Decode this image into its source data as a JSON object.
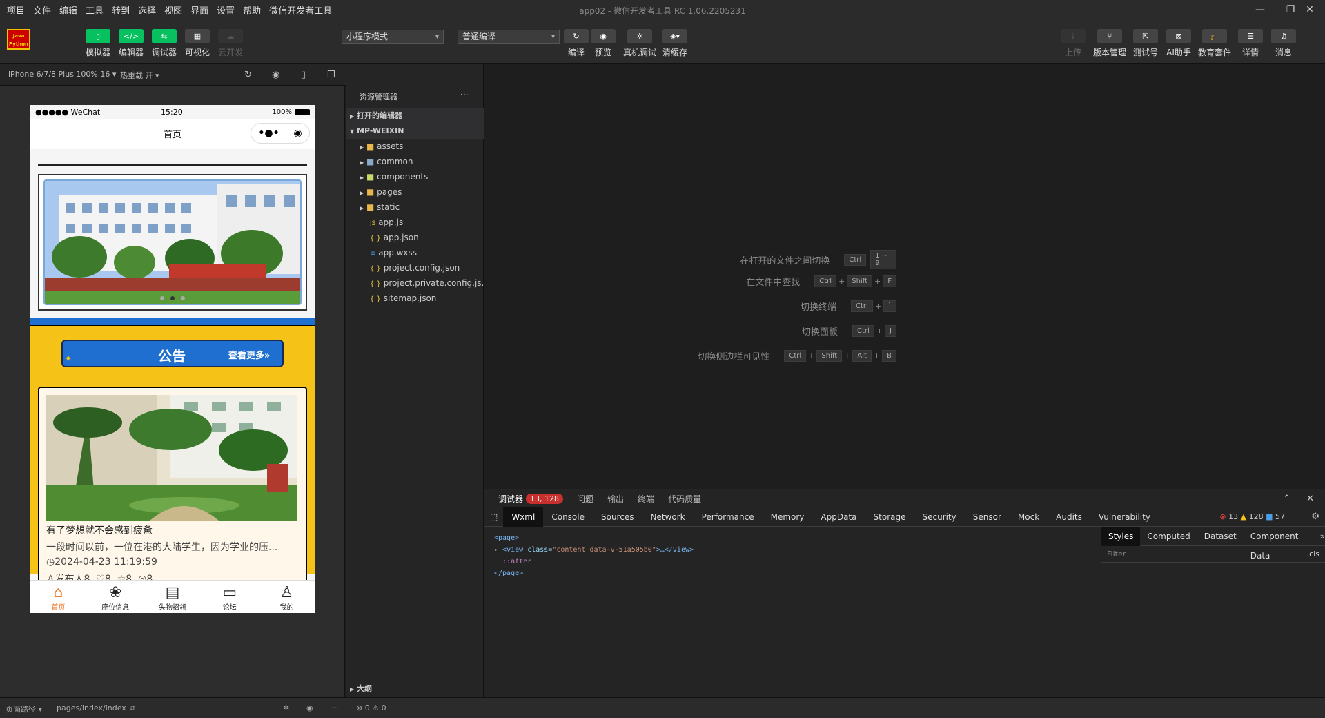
{
  "menu": {
    "items": [
      "项目",
      "文件",
      "编辑",
      "工具",
      "转到",
      "选择",
      "视图",
      "界面",
      "设置",
      "帮助",
      "微信开发者工具"
    ],
    "title": "app02 - 微信开发者工具 RC 1.06.2205231"
  },
  "toolbar": {
    "logo_line1": "Java",
    "logo_line2": "Python",
    "left": [
      {
        "label": "模拟器",
        "icon": "phone-icon"
      },
      {
        "label": "编辑器",
        "icon": "code-icon"
      },
      {
        "label": "调试器",
        "icon": "debug-icon"
      },
      {
        "label": "可视化",
        "icon": "layout-icon"
      },
      {
        "label": "云开发",
        "icon": "cloud-icon"
      }
    ],
    "mode_select": "小程序模式",
    "compile_select": "普通编译",
    "center": [
      {
        "label": "编译"
      },
      {
        "label": "预览"
      },
      {
        "label": "真机调试"
      },
      {
        "label": "清缓存"
      }
    ],
    "right": [
      {
        "label": "上传"
      },
      {
        "label": "版本管理"
      },
      {
        "label": "测试号"
      },
      {
        "label": "AI助手"
      },
      {
        "label": "教育套件"
      },
      {
        "label": "详情"
      },
      {
        "label": "消息"
      }
    ]
  },
  "simbar": {
    "device": "iPhone 6/7/8 Plus 100% 16 ▾",
    "hotreload": "热重载 开 ▾"
  },
  "phone": {
    "carrier": "●●●●● WeChat",
    "time": "15:20",
    "battery": "100%",
    "nav_title": "首页",
    "capsule_more": "•●•",
    "capsule_close": "◉",
    "notice_title": "公告",
    "notice_more": "查看更多»",
    "card": {
      "title": "有了梦想就不会感到疲惫",
      "desc": "一段时间以前，一位在港的大陆学生，因为学业的压...",
      "time": "◷2024-04-23 11:19:59",
      "author": "♙发布人8",
      "likes": "♡8",
      "stars": "☆8",
      "views": "◎8"
    },
    "tabs": [
      {
        "label": "首页",
        "active": true
      },
      {
        "label": "座位信息",
        "active": false
      },
      {
        "label": "失物招领",
        "active": false
      },
      {
        "label": "论坛",
        "active": false
      },
      {
        "label": "我的",
        "active": false
      }
    ]
  },
  "explorer": {
    "header": "资源管理器",
    "more": "···",
    "open_editors": "打开的编辑器",
    "project": "MP-WEIXIN",
    "folders": [
      "assets",
      "common",
      "components",
      "pages",
      "static"
    ],
    "files": [
      {
        "name": "app.js",
        "icon": "JS"
      },
      {
        "name": "app.json",
        "icon": "{ }"
      },
      {
        "name": "app.wxss",
        "icon": "≡"
      },
      {
        "name": "project.config.json",
        "icon": "{ }"
      },
      {
        "name": "project.private.config.js...",
        "icon": "{ }"
      },
      {
        "name": "sitemap.json",
        "icon": "{ }"
      }
    ],
    "outline": "大纲",
    "problems": "⊗ 0 ⚠ 0"
  },
  "hints": [
    {
      "text": "在打开的文件之间切换",
      "keys": [
        "Ctrl",
        "1 ~ 9"
      ]
    },
    {
      "text": "在文件中查找",
      "keys": [
        "Ctrl",
        "Shift",
        "F"
      ]
    },
    {
      "text": "切换终端",
      "keys": [
        "Ctrl",
        "`"
      ]
    },
    {
      "text": "切换面板",
      "keys": [
        "Ctrl",
        "J"
      ]
    },
    {
      "text": "切换侧边栏可见性",
      "keys": [
        "Ctrl",
        "Shift",
        "Alt",
        "B"
      ]
    }
  ],
  "devtools": {
    "header": {
      "debugger": "调试器",
      "badge": "13, 128",
      "issues": "问题",
      "output": "输出",
      "terminal": "终端",
      "quality": "代码质量"
    },
    "tabs": [
      "Wxml",
      "Console",
      "Sources",
      "Network",
      "Performance",
      "Memory",
      "AppData",
      "Storage",
      "Security",
      "Sensor",
      "Mock",
      "Audits",
      "Vulnerability"
    ],
    "errors": "13",
    "warnings": "128",
    "infos": "57",
    "code": {
      "l1": "<page>",
      "l2a": "<view ",
      "l2b": "class=",
      "l2c": "\"content data-v-51a505b0\"",
      "l2d": ">…</view>",
      "l3": "::after",
      "l4": "</page>"
    },
    "style_tabs": [
      "Styles",
      "Computed",
      "Dataset",
      "Component Data"
    ],
    "filter": "Filter",
    "cls": ".cls"
  },
  "bottom": {
    "path_label": "页面路径 ▾",
    "path": "pages/index/index"
  }
}
